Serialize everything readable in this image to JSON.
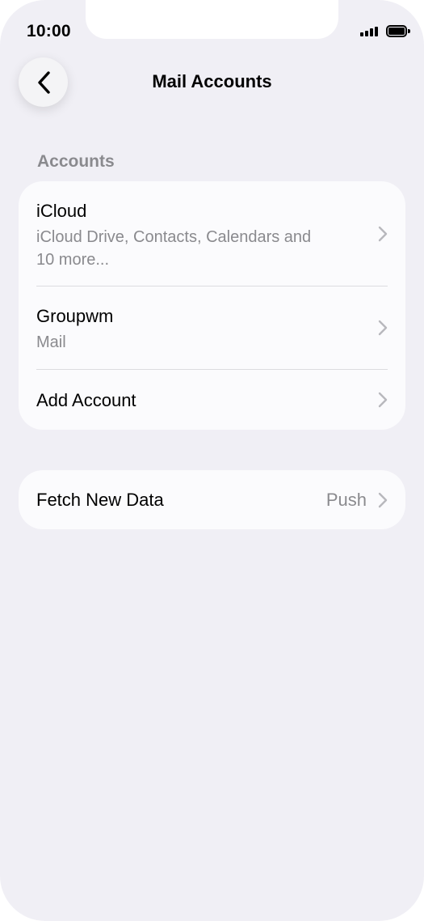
{
  "status_bar": {
    "time": "10:00",
    "signal_icon": "cellular-signal-icon",
    "battery_icon": "battery-icon"
  },
  "nav": {
    "back_icon": "chevron-left-icon",
    "title": "Mail Accounts"
  },
  "accounts_section": {
    "header": "Accounts",
    "items": [
      {
        "title": "iCloud",
        "subtitle_line1": "iCloud Drive, Contacts, Calendars and",
        "subtitle_line2": "10 more..."
      },
      {
        "title": "Groupwm",
        "subtitle_line1": "Mail"
      },
      {
        "title": "Add Account"
      }
    ]
  },
  "fetch_section": {
    "label": "Fetch New Data",
    "value": "Push"
  },
  "colors": {
    "background": "#f0eff5",
    "card": "#fbfbfd",
    "secondary_text": "#8a8a8e",
    "chevron": "#b8b8bd"
  }
}
